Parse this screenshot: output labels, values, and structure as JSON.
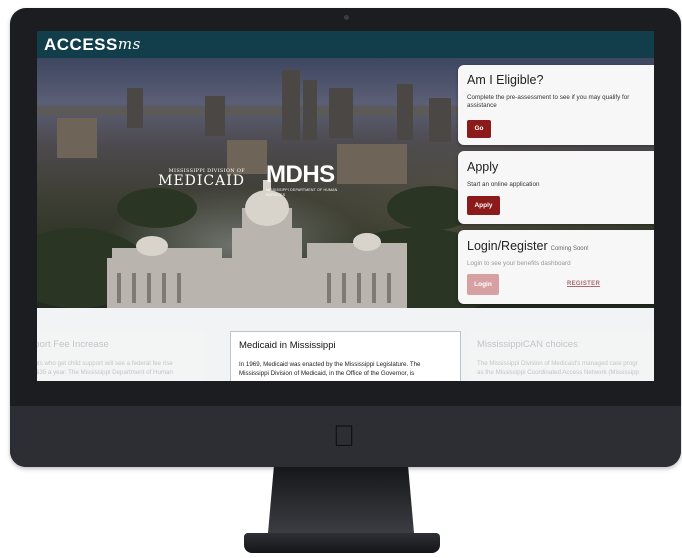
{
  "header": {
    "logo_access": "ACCESS",
    "logo_ms": "ms"
  },
  "hero": {
    "medicaid_small": "MISSISSIPPI DIVISION OF",
    "medicaid_big": "MEDICAID",
    "mdhs_big": "MDHS",
    "mdhs_small": "MISSISSIPPI DEPARTMENT OF HUMAN SERVICES"
  },
  "cards": {
    "eligible": {
      "title": "Am I Eligible?",
      "text": "Complete the pre-assessment to see if you may qualify for assistance",
      "button": "Go"
    },
    "apply": {
      "title": "Apply",
      "text": "Start an online application",
      "button": "Apply"
    },
    "login": {
      "title": "Login/Register",
      "coming": "Coming Soon!",
      "text": "Login to see your benefits dashboard",
      "button": "Login",
      "register": "REGISTER"
    }
  },
  "news": {
    "left": {
      "title": "pport Fee Increase",
      "text": "rents who get child support will see a federal fee rise\nto $35 a year. The Mississippi Department of Human"
    },
    "mid": {
      "title": "Medicaid in Mississippi",
      "text": "In 1969, Medicaid was enacted by the Mississippi Legislature. The\nMississippi Division of Medicaid, in the Office of the Governor, is"
    },
    "right": {
      "title": "MississippiCAN choices",
      "text": "The Mississippi Division of Medicaid's managed care progr\nas the Mississippi Coordinated Access Network (Mississipp"
    }
  },
  "colors": {
    "header_bg": "#123e4c",
    "button_red": "#8b1a1a",
    "button_disabled": "#d7a0a3"
  }
}
